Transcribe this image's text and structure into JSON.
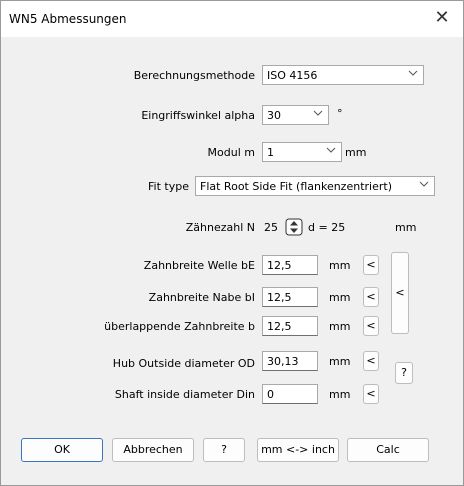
{
  "window": {
    "title": "WN5 Abmessungen",
    "close_glyph": "✕"
  },
  "method": {
    "label": "Berechnungsmethode",
    "value": "ISO 4156"
  },
  "alpha": {
    "label": "Eingriffswinkel alpha",
    "value": "30",
    "unit": "°"
  },
  "modul": {
    "label": "Modul m",
    "value": "1",
    "unit": "mm"
  },
  "fit": {
    "label": "Fit type",
    "value": "Flat Root Side Fit (flankenzentriert)"
  },
  "teeth": {
    "label": "Zähnezahl N",
    "value": "25",
    "d_text": "d = 25",
    "unit": "mm"
  },
  "rows": [
    {
      "label": "Zahnbreite Welle bE",
      "value": "12,5",
      "unit": "mm",
      "btn": "<"
    },
    {
      "label": "Zahnbreite Nabe bI",
      "value": "12,5",
      "unit": "mm",
      "btn": "<"
    },
    {
      "label": "überlappende Zahnbreite b",
      "value": "12,5",
      "unit": "mm",
      "btn": "<"
    }
  ],
  "group_btn": "<",
  "hub": {
    "label": "Hub Outside diameter OD",
    "value": "30,13",
    "unit": "mm",
    "btn": "<"
  },
  "shaft": {
    "label": "Shaft inside diameter  Din",
    "value": "0",
    "unit": "mm",
    "btn": "<"
  },
  "question_small": "?",
  "footer": {
    "ok": "OK",
    "cancel": "Abbrechen",
    "help": "?",
    "convert": "mm <-> inch",
    "calc": "Calc"
  }
}
